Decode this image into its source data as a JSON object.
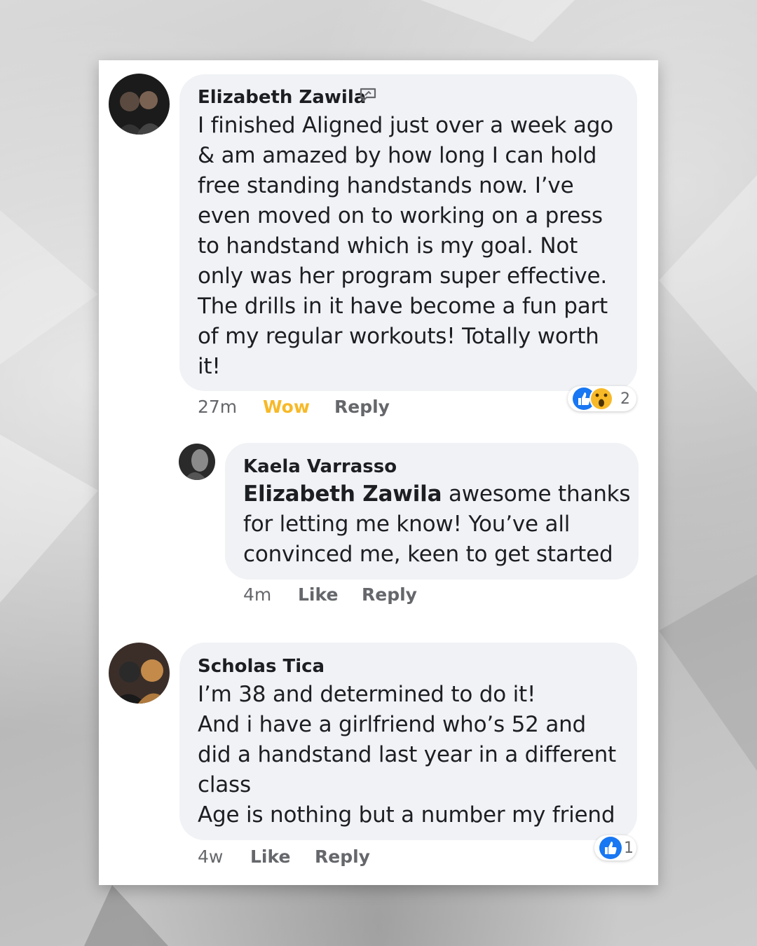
{
  "comments": [
    {
      "author": "Elizabeth Zawila",
      "lines": [
        "I finished Aligned just over a week ago",
        "& am amazed by how long I can hold",
        "free standing handstands now. I’ve",
        "even moved on to working on a press",
        "to handstand which is my goal. Not",
        "only was her program super effective.",
        "The drills in it have become a fun part",
        "of my regular workouts! Totally worth",
        "it!"
      ],
      "time": "27m",
      "like_label": "Wow",
      "reply_label": "Reply",
      "reaction_count": "2",
      "reaction_icons": [
        "like-icon",
        "wow-icon"
      ],
      "colors": {
        "wow": "#f7b928",
        "like": "#1877f2"
      }
    },
    {
      "author": "Kaela Varrasso",
      "mention": "Elizabeth Zawila",
      "first_line_rest": " awesome thanks",
      "lines": [
        "for letting me know! You’ve all",
        "convinced me, keen to get started"
      ],
      "time": "4m",
      "like_label": "Like",
      "reply_label": "Reply"
    },
    {
      "author": "Scholas Tica",
      "lines": [
        "I’m 38 and determined to do it!",
        "And i have a girlfriend who’s 52 and",
        "did a handstand last year in a different",
        "class",
        "Age is nothing but a number my friend"
      ],
      "time": "4w",
      "like_label": "Like",
      "reply_label": "Reply",
      "reaction_count": "1",
      "reaction_icons": [
        "like-icon"
      ]
    }
  ]
}
